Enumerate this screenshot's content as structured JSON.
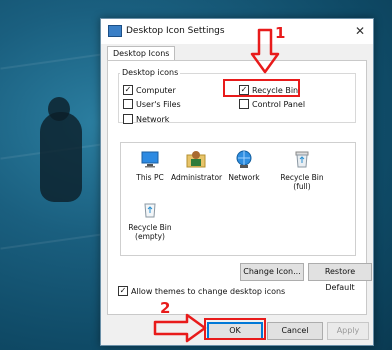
{
  "dialog": {
    "title": "Desktop Icon Settings",
    "tab": "Desktop Icons",
    "group_title": "Desktop icons",
    "checkboxes": [
      {
        "label": "Computer",
        "checked": true
      },
      {
        "label": "User's Files",
        "checked": false
      },
      {
        "label": "Network",
        "checked": false
      },
      {
        "label": "Recycle Bin",
        "checked": true
      },
      {
        "label": "Control Panel",
        "checked": false
      }
    ],
    "icons": [
      {
        "label": "This PC",
        "icon": "this-pc-icon"
      },
      {
        "label": "Administrator",
        "icon": "user-folder-icon"
      },
      {
        "label": "Network",
        "icon": "network-globe-icon"
      },
      {
        "label": "Recycle Bin\n(full)",
        "icon": "recycle-bin-full-icon"
      },
      {
        "label": "Recycle Bin\n(empty)",
        "icon": "recycle-bin-empty-icon"
      }
    ],
    "change_icon": "Change Icon...",
    "restore_default": "Restore Default",
    "allow_themes": {
      "label": "Allow themes to change desktop icons",
      "checked": true
    },
    "ok": "OK",
    "cancel": "Cancel",
    "apply": "Apply"
  },
  "annotations": {
    "step1": "1",
    "step2": "2",
    "color": "#e81b1b"
  }
}
